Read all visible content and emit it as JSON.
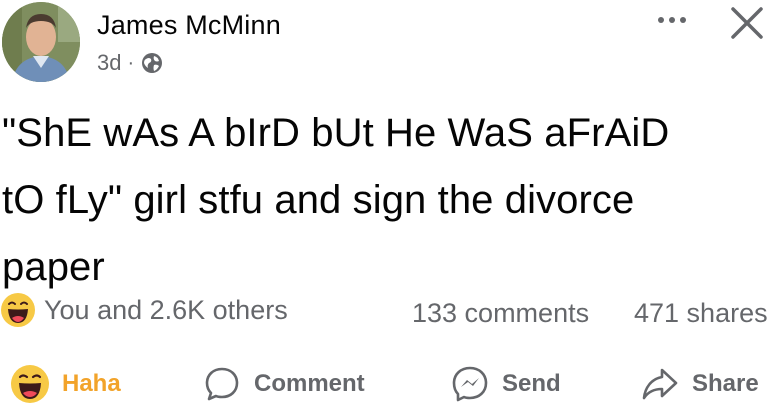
{
  "post": {
    "author": {
      "name": "James McMinn",
      "avatar_icon": "profile-photo"
    },
    "meta": {
      "time": "3d",
      "separator": "·",
      "audience_icon": "globe-icon"
    },
    "text": "\"ShE wAs A bIrD bUt He WaS aFrAiD\ntO fLy\" girl stfu and sign the divorce\npaper"
  },
  "stats": {
    "reaction_icon": "haha-emoji-icon",
    "reactions_text": "You and 2.6K others",
    "comments_text": "133 comments",
    "shares_text": "471 shares"
  },
  "actions": {
    "haha_label": "Haha",
    "comment_label": "Comment",
    "send_label": "Send",
    "share_label": "Share"
  },
  "colors": {
    "text": "#050505",
    "secondary": "#65676b",
    "haha_accent": "#f2a32a",
    "emoji_yellow": "#f7c945",
    "emoji_mouth": "#3d1a1a",
    "emoji_tongue": "#f04a5a"
  }
}
